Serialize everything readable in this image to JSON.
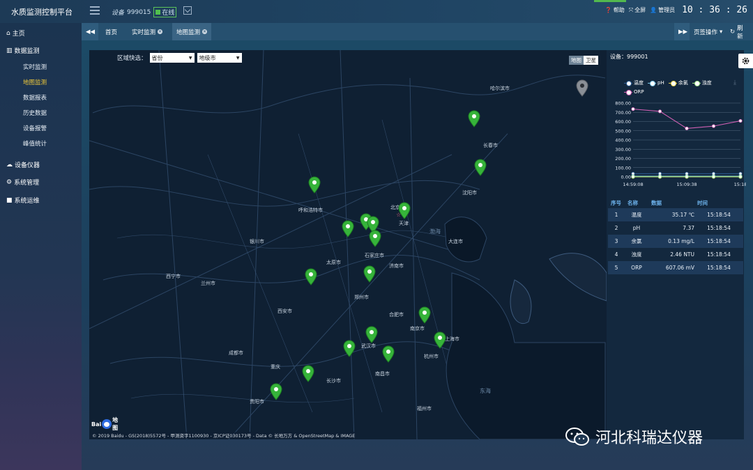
{
  "app": {
    "title": "水质监测控制平台"
  },
  "topbar": {
    "device_label": "设备",
    "device_id": "999015",
    "online_status": "在线",
    "help_label": "帮助",
    "fullscreen_label": "全屏",
    "user_label": "管理员",
    "clock": "10 : 36 : 26"
  },
  "sidebar": {
    "home": "主页",
    "data_monitoring": "数据监测",
    "sub_items": [
      "实时监测",
      "地图监测",
      "数据报表",
      "历史数据",
      "设备报警",
      "峰值统计"
    ],
    "active_sub": "地图监测",
    "device_instruments": "设备仪器",
    "system_management": "系统管理",
    "system_ops": "系统运维"
  },
  "tabs": {
    "home": "首页",
    "items": [
      "实时监测",
      "地图监测"
    ],
    "page_ops": "页签操作",
    "refresh": "刷新"
  },
  "map": {
    "region_label": "区域快选：",
    "province_value": "省份",
    "city_value": "地级市",
    "map_types": [
      "地图",
      "卫星"
    ],
    "credit": "© 2019 Baidu - GS(2018)5572号 - 甲测资字1100930 - 京ICP证030173号 - Data © 长地万方 & OpenStreetMap & IMAGE",
    "logo_text": "Baidu 地图",
    "place_labels": {
      "bohai": "渤海",
      "donghai": "东海",
      "beijing": "北京",
      "tianjin": "天津",
      "haerbin": "哈尔滨市",
      "changchun": "长春市",
      "shenyang": "沈阳市",
      "dalian": "大连市",
      "jinan": "济南市",
      "shijiazhuang": "石家庄市",
      "taiyuan": "太原市",
      "zhengzhou": "郑州市",
      "xian": "西安市",
      "wuhan": "武汉市",
      "nanjing": "南京市",
      "shanghai": "上海市",
      "hangzhou": "杭州市",
      "changsha": "长沙市",
      "chongqing": "重庆",
      "chengdu": "成都市",
      "lanzhou": "兰州市",
      "yinchuan": "银川市",
      "huhehaote": "呼和浩特市",
      "xining": "西宁市",
      "guiyang": "贵阳市",
      "nanchang": "南昌市",
      "hefei": "合肥市",
      "fuzhou": "福州市"
    }
  },
  "device_panel": {
    "title": "设备：999001",
    "legend": [
      {
        "name": "温度",
        "color": "#2c5b92"
      },
      {
        "name": "pH",
        "color": "#7dc6e6"
      },
      {
        "name": "余氯",
        "color": "#f0d84a"
      },
      {
        "name": "浊度",
        "color": "#9ee28a"
      },
      {
        "name": "ORP",
        "color": "#d060b4"
      }
    ],
    "table_headers": [
      "序号",
      "名称",
      "数据",
      "时间"
    ],
    "table_rows": [
      [
        "1",
        "温度",
        "35.17 ℃",
        "15:18:54"
      ],
      [
        "2",
        "pH",
        "7.37",
        "15:18:54"
      ],
      [
        "3",
        "余氯",
        "0.13 mg/L",
        "15:18:54"
      ],
      [
        "4",
        "浊度",
        "2.46 NTU",
        "15:18:54"
      ],
      [
        "5",
        "ORP",
        "607.06 mV",
        "15:18:54"
      ]
    ]
  },
  "chart_data": {
    "type": "line",
    "x": [
      "14:59:08",
      "15:04:19",
      "15:09:30",
      "15:14:41",
      "15:18:54"
    ],
    "x_tick_labels": [
      "14:59:08",
      "15:09:38",
      "15:18"
    ],
    "y_tick_labels": [
      "0.00",
      "100.00",
      "200.00",
      "300.00",
      "400.00",
      "500.00",
      "600.00",
      "700.00",
      "800.00"
    ],
    "ylim": [
      0,
      800
    ],
    "series": [
      {
        "name": "ORP",
        "color": "#d060b4",
        "values": [
          735,
          710,
          525,
          550,
          607
        ]
      },
      {
        "name": "温度",
        "color": "#2c5b92",
        "values": [
          35,
          35,
          35,
          35,
          35
        ]
      },
      {
        "name": "pH",
        "color": "#7dc6e6",
        "values": [
          7,
          7,
          7,
          7,
          7
        ]
      },
      {
        "name": "余氯",
        "color": "#f0d84a",
        "values": [
          0.1,
          0.1,
          0.1,
          0.1,
          0.1
        ]
      },
      {
        "name": "浊度",
        "color": "#9ee28a",
        "values": [
          2,
          2,
          2,
          2,
          2
        ]
      }
    ]
  },
  "watermark": {
    "text": "河北科瑞达仪器"
  }
}
